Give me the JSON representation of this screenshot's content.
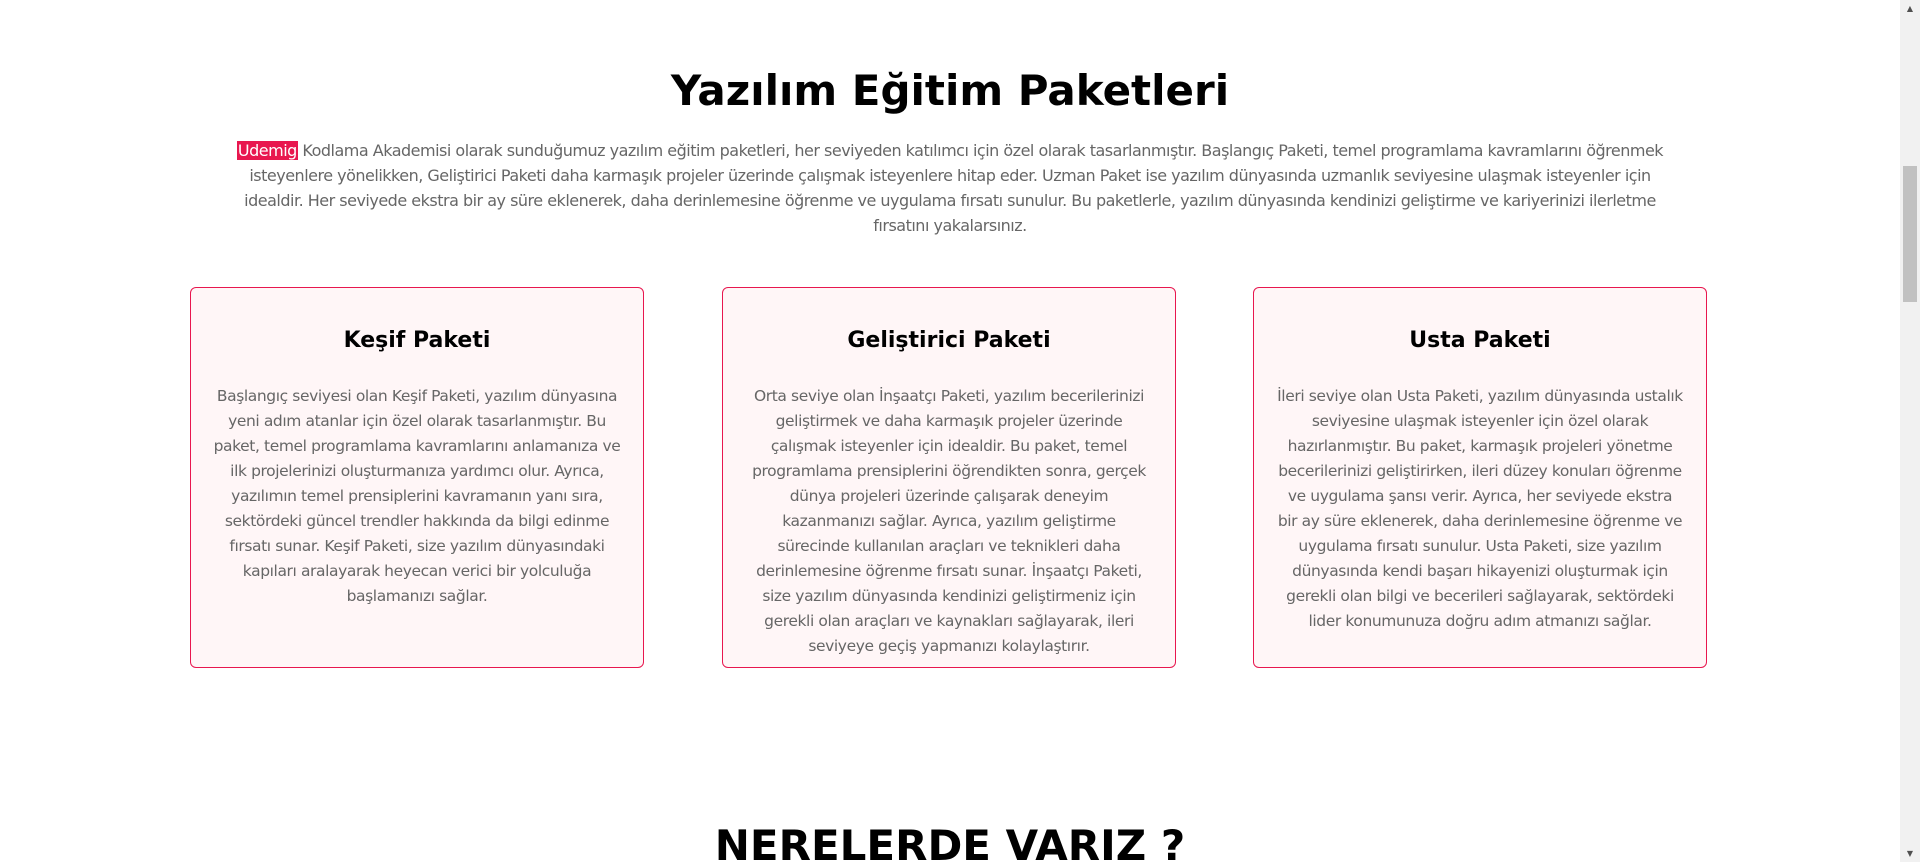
{
  "packages_section": {
    "title": "Yazılım Eğitim Paketleri",
    "intro_brand": "Udemig",
    "intro_text": " Kodlama Akademisi olarak sunduğumuz yazılım eğitim paketleri, her seviyeden katılımcı için özel olarak tasarlanmıştır. Başlangıç Paketi, temel programlama kavramlarını öğrenmek isteyenlere yönelikken, Geliştirici Paketi daha karmaşık projeler üzerinde çalışmak isteyenlere hitap eder. Uzman Paket ise yazılım dünyasında uzmanlık seviyesine ulaşmak isteyenler için idealdir. Her seviyede ekstra bir ay süre eklenerek, daha derinlemesine öğrenme ve uygulama fırsatı sunulur. Bu paketlerle, yazılım dünyasında kendinizi geliştirme ve kariyerinizi ilerletme fırsatını yakalarsınız.",
    "cards": [
      {
        "title": "Keşif Paketi",
        "text": "Başlangıç seviyesi olan Keşif Paketi, yazılım dünyasına yeni adım atanlar için özel olarak tasarlanmıştır. Bu paket, temel programlama kavramlarını anlamanıza ve ilk projelerinizi oluşturmanıza yardımcı olur. Ayrıca, yazılımın temel prensiplerini kavramanın yanı sıra, sektördeki güncel trendler hakkında da bilgi edinme fırsatı sunar. Keşif Paketi, size yazılım dünyasındaki kapıları aralayarak heyecan verici bir yolculuğa başlamanızı sağlar."
      },
      {
        "title": "Geliştirici Paketi",
        "text": "Orta seviye olan İnşaatçı Paketi, yazılım becerilerinizi geliştirmek ve daha karmaşık projeler üzerinde çalışmak isteyenler için idealdir. Bu paket, temel programlama prensiplerini öğrendikten sonra, gerçek dünya projeleri üzerinde çalışarak deneyim kazanmanızı sağlar. Ayrıca, yazılım geliştirme sürecinde kullanılan araçları ve teknikleri daha derinlemesine öğrenme fırsatı sunar. İnşaatçı Paketi, size yazılım dünyasında kendinizi geliştirmeniz için gerekli olan araçları ve kaynakları sağlayarak, ileri seviyeye geçiş yapmanızı kolaylaştırır."
      },
      {
        "title": "Usta Paketi",
        "text": "İleri seviye olan Usta Paketi, yazılım dünyasında ustalık seviyesine ulaşmak isteyenler için özel olarak hazırlanmıştır. Bu paket, karmaşık projeleri yönetme becerilerinizi geliştirirken, ileri düzey konuları öğrenme ve uygulama şansı verir. Ayrıca, her seviyede ekstra bir ay süre eklenerek, daha derinlemesine öğrenme ve uygulama fırsatı sunulur. Usta Paketi, size yazılım dünyasında kendi başarı hikayenizi oluşturmak için gerekli olan bilgi ve becerileri sağlayarak, sektördeki lider konumunuza doğru adım atmanızı sağlar."
      }
    ]
  },
  "locations_section": {
    "title": "NERELERDE VARIZ ?"
  },
  "scrollbar": {
    "up_icon": "triangle-up-icon",
    "down_icon": "triangle-down-icon",
    "position_fraction": 0.18
  },
  "colors": {
    "accent": "#e8174f",
    "card_background": "#fff6f7",
    "heading": "#000000",
    "body_text": "#666666"
  }
}
